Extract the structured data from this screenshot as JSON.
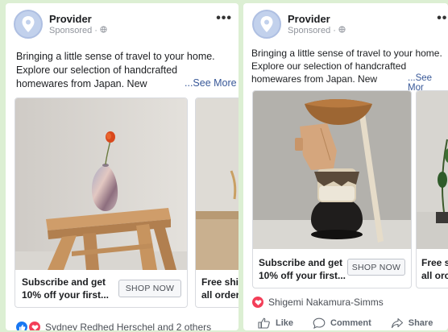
{
  "post": {
    "provider_name": "Provider",
    "sponsored": "Sponsored · ",
    "text_lines": [
      "Bringing a little sense of travel to your home.",
      "Explore our selection of handcrafted",
      "homewares from Japan. New"
    ],
    "see_more_a": "...See More",
    "see_more_b": "...See Mor"
  },
  "carousel": {
    "cta_line1": "Subscribe and get",
    "cta_line2": "10% off your first...",
    "shop_button": "SHOP NOW",
    "next_line1_a": "Free shi",
    "next_line2_a": "all order",
    "next_line1_b": "Free s",
    "next_line2_b": "all orc"
  },
  "reactions": {
    "left_text": "Sydney Redhed Herschel and 2 others",
    "right_text": "Shigemi Nakamura-Simms"
  },
  "actions": {
    "like": "Like",
    "comment": "Comment",
    "share": "Share"
  },
  "colors": {
    "background": "#dcefd3",
    "link": "#385898",
    "like_blue": "#1877f2",
    "love_red": "#f33e58"
  }
}
